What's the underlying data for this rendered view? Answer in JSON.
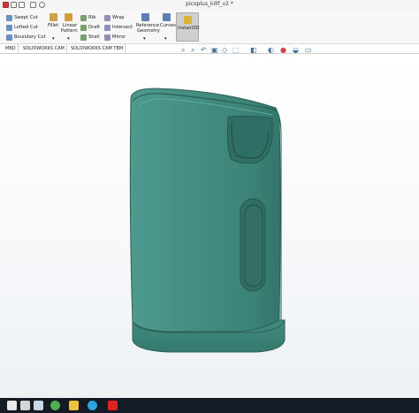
{
  "window": {
    "title": "picoplus_killf_v2 *"
  },
  "ribbon": {
    "swept_cut": "Swept Cut",
    "lofted_cut": "Lofted Cut",
    "boundary_cut": "Boundary Cut",
    "fillet": "Fillet",
    "linear_pattern_1": "Linear",
    "linear_pattern_2": "Pattern",
    "rib": "Rib",
    "draft": "Draft",
    "shell": "Shell",
    "wrap": "Wrap",
    "intersect": "Intersect",
    "mirror": "Mirror",
    "reference_geometry_1": "Reference",
    "reference_geometry_2": "Geometry",
    "curves": "Curves",
    "instant3d": "Instant3D"
  },
  "tabs": [
    "MBD",
    "SOLIDWORKS CAM",
    "SOLIDWORKS CAM TBM"
  ],
  "colors": {
    "model": "#3f8a7f",
    "taskbar": "#151b24"
  }
}
